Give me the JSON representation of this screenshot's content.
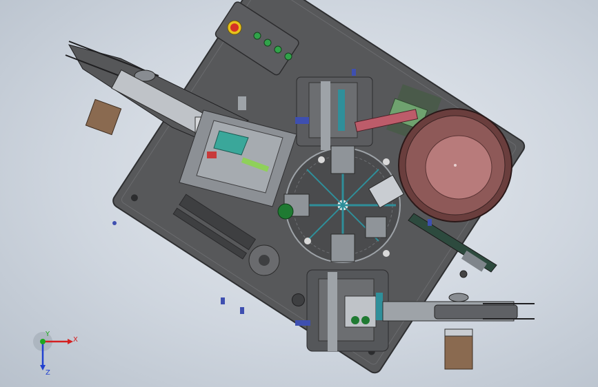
{
  "viewport": {
    "background_top": "#e6eaef",
    "background_bottom": "#b8c1cc"
  },
  "colors": {
    "plate": "#57585a",
    "plate_dark": "#3e3f41",
    "steel": "#9ea3a8",
    "steel_light": "#c9cdd2",
    "bowl_outer": "#7a4948",
    "bowl_inner": "#b87b7b",
    "green_part": "#1f7a32",
    "teal_part": "#3aa79a",
    "accent_blue": "#3e4fb0",
    "bronze": "#8a6a50",
    "button_red": "#d63226",
    "button_yellow": "#e8c21c",
    "button_green": "#31a34a"
  },
  "control_panel": {
    "icons": [
      "emergency-stop-button",
      "start-button",
      "stop-button",
      "reset-button",
      "mode-button"
    ]
  },
  "triad": {
    "x_label": "X",
    "y_label": "Y",
    "z_label": "Z",
    "x_color": "#d42020",
    "y_color": "#1ea81e",
    "z_color": "#2040d0"
  }
}
